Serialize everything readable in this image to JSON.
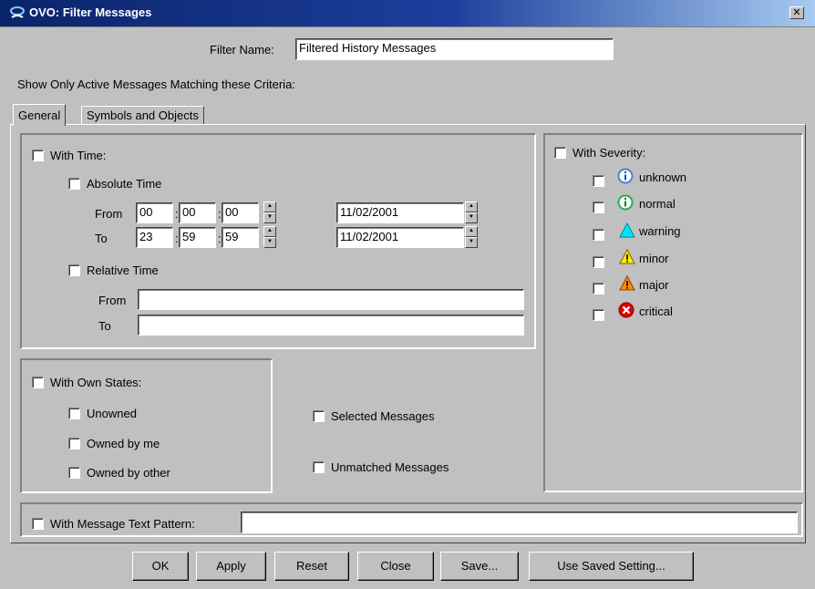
{
  "window": {
    "title": "OVO: Filter Messages",
    "close_label": "✕"
  },
  "filter_name": {
    "label": "Filter Name:",
    "value": "Filtered History Messages"
  },
  "criteria_label": "Show Only Active Messages Matching these Criteria:",
  "tabs": [
    {
      "label": "General"
    },
    {
      "label": "Symbols and Objects"
    }
  ],
  "time": {
    "label": "With Time:",
    "absolute": {
      "label": "Absolute Time",
      "from_label": "From",
      "to_label": "To",
      "from": {
        "hh": "00",
        "mm": "00",
        "ss": "00",
        "date": "11/02/2001"
      },
      "to": {
        "hh": "23",
        "mm": "59",
        "ss": "59",
        "date": "11/02/2001"
      }
    },
    "relative": {
      "label": "Relative Time",
      "from_label": "From",
      "to_label": "To",
      "from_value": "",
      "to_value": ""
    }
  },
  "severity": {
    "label": "With Severity:",
    "items": [
      {
        "label": "unknown",
        "icon": "info-blue-icon",
        "color": "#4a7fdc"
      },
      {
        "label": "normal",
        "icon": "info-green-icon",
        "color": "#22b14c"
      },
      {
        "label": "warning",
        "icon": "triangle-cyan-icon",
        "color": "#00e5ff"
      },
      {
        "label": "minor",
        "icon": "warning-yellow-icon",
        "color": "#ffee00"
      },
      {
        "label": "major",
        "icon": "warning-orange-icon",
        "color": "#ff8c00"
      },
      {
        "label": "critical",
        "icon": "error-red-icon",
        "color": "#e00000"
      }
    ]
  },
  "own_states": {
    "label": "With Own States:",
    "items": [
      {
        "label": "Unowned"
      },
      {
        "label": "Owned by me"
      },
      {
        "label": "Owned by other"
      }
    ]
  },
  "selected_messages": "Selected Messages",
  "unmatched_messages": "Unmatched Messages",
  "text_pattern": {
    "label": "With Message Text Pattern:",
    "value": ""
  },
  "buttons": {
    "ok": "OK",
    "apply": "Apply",
    "reset": "Reset",
    "close": "Close",
    "save": "Save...",
    "use_saved": "Use Saved Setting..."
  }
}
